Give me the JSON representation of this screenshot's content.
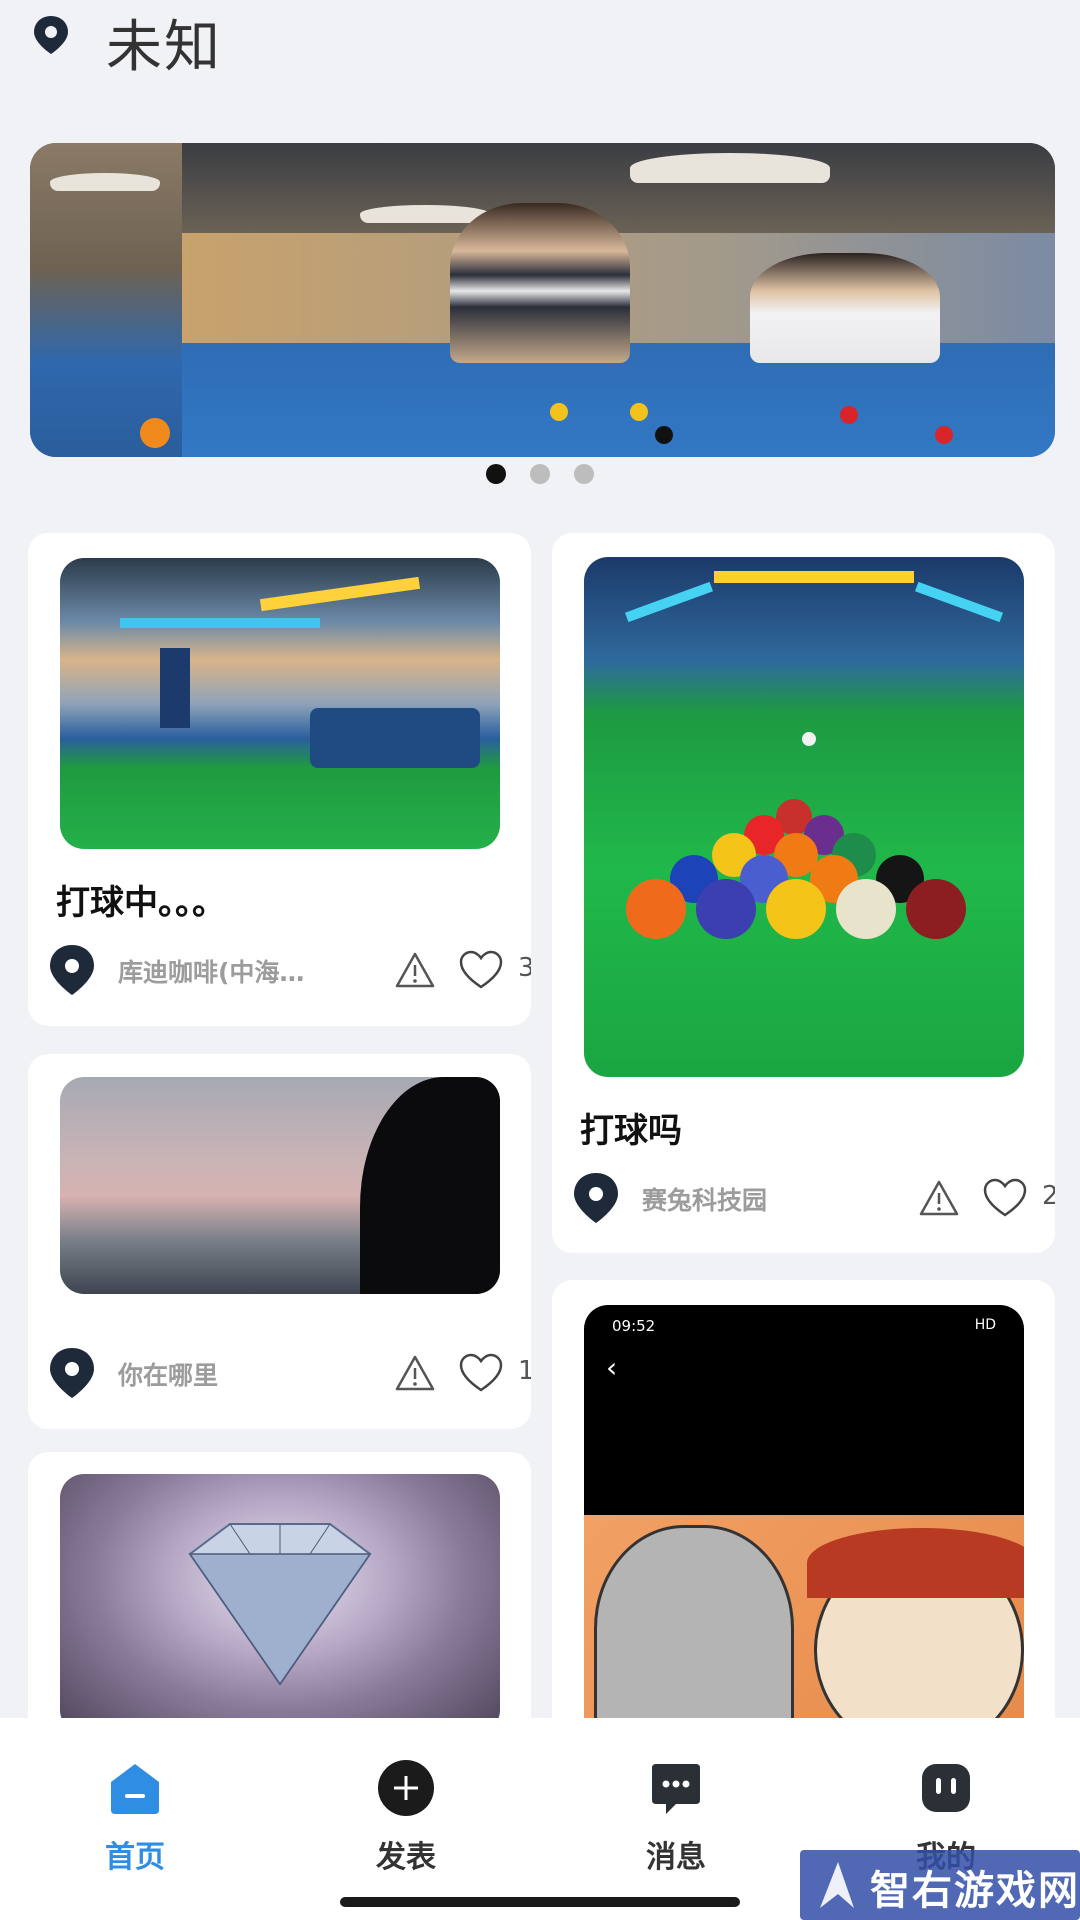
{
  "header": {
    "title": "未知"
  },
  "banner": {
    "dots": 3,
    "active_dot": 0
  },
  "feed": {
    "left": [
      {
        "title": "打球中。。。",
        "location": "库迪咖啡(中海…",
        "likes": "3"
      },
      {
        "title": "",
        "location": "你在哪里",
        "likes": "1"
      },
      {
        "title": "",
        "location": "",
        "likes": ""
      }
    ],
    "right": [
      {
        "title": "打球吗",
        "location": "赛兔科技园",
        "likes": "2"
      },
      {
        "phone_time": "09:52",
        "phone_status": "HD"
      }
    ]
  },
  "nav": {
    "items": [
      {
        "label": "首页",
        "icon": "home-icon",
        "active": true
      },
      {
        "label": "发表",
        "icon": "plus-circle-icon",
        "active": false
      },
      {
        "label": "消息",
        "icon": "message-icon",
        "active": false
      },
      {
        "label": "我的",
        "icon": "profile-icon",
        "active": false
      }
    ]
  },
  "watermark": {
    "text": "智右游戏网"
  },
  "colors": {
    "accent": "#2f8de4",
    "pin": "#1e2a3a",
    "background": "#f1f2f6"
  }
}
